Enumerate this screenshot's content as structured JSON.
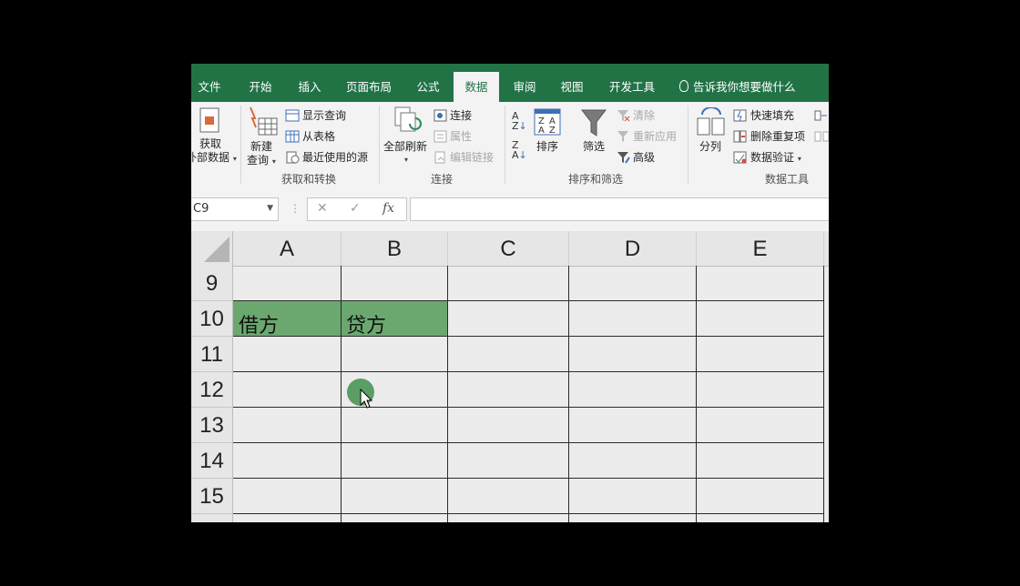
{
  "tabs": [
    {
      "label": "文件"
    },
    {
      "label": "开始"
    },
    {
      "label": "插入"
    },
    {
      "label": "页面布局"
    },
    {
      "label": "公式"
    },
    {
      "label": "数据"
    },
    {
      "label": "审阅"
    },
    {
      "label": "视图"
    },
    {
      "label": "开发工具"
    }
  ],
  "tell_me": "告诉我你想要做什么",
  "ribbon": {
    "get_data_line1": "获取",
    "get_data_line2": "外部数据",
    "new_query_line1": "新建",
    "new_query_line2": "查询",
    "show_queries": "显示查询",
    "from_table": "从表格",
    "recent_sources": "最近使用的源",
    "group_get_transform": "获取和转换",
    "refresh_all": "全部刷新",
    "connections": "连接",
    "properties": "属性",
    "edit_links": "编辑链接",
    "group_connections": "连接",
    "sort": "排序",
    "filter": "筛选",
    "clear": "清除",
    "reapply": "重新应用",
    "advanced": "高级",
    "group_sort_filter": "排序和筛选",
    "text_to_columns": "分列",
    "flash_fill": "快速填充",
    "remove_duplicates": "删除重复项",
    "data_validation": "数据验证",
    "group_data_tools": "数据工具"
  },
  "formula_bar": {
    "name_box": "C9",
    "cancel_symbol": "✕",
    "enter_symbol": "✓",
    "fx_symbol": "fx",
    "formula": ""
  },
  "grid": {
    "columns": [
      "A",
      "B",
      "C",
      "D",
      "E"
    ],
    "rows": [
      "9",
      "10",
      "11",
      "12",
      "13",
      "14",
      "15"
    ],
    "cells": {
      "A10": "借方",
      "B10": "贷方"
    }
  },
  "colors": {
    "accent": "#217346",
    "header_fill": "#6aa870",
    "cursor_dot": "#5a9e66"
  }
}
